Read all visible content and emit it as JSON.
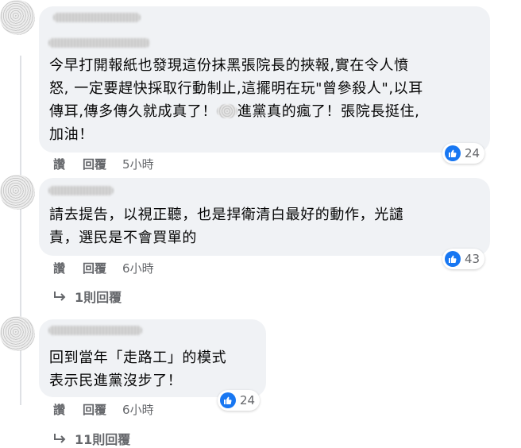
{
  "comments": [
    {
      "text_before": "今早打開報紙也發現這份抹黑張院長的挾報,實在令人憤\n怒, 一定要趕快採取行動制止,這擺明在玩\"曾參殺人\",以耳\n傳耳,傳多傳久就成真了！",
      "text_after": "進黨真的瘋了！張院長挺住,\n加油！",
      "like_count": "24",
      "action_like": "讚",
      "action_reply": "回覆",
      "time": "5小時"
    },
    {
      "text": "請去提告，以視正聽，也是捍衛清白最好的動作，光譴\n責，選民是不會買單的",
      "like_count": "43",
      "action_like": "讚",
      "action_reply": "回覆",
      "time": "6小時",
      "replies_link": "1則回覆"
    },
    {
      "text": "回到當年「走路工」的模式\n表示民進黨沒步了！",
      "like_count": "24",
      "action_like": "讚",
      "action_reply": "回覆",
      "time": "6小時",
      "replies_link": "11則回覆"
    }
  ],
  "icons": {
    "like": "thumbs-up-icon",
    "reply": "reply-arrow-icon"
  },
  "colors": {
    "like_blue": "#1877f2",
    "bubble_bg": "#f0f2f5",
    "meta_gray": "#65676b"
  }
}
